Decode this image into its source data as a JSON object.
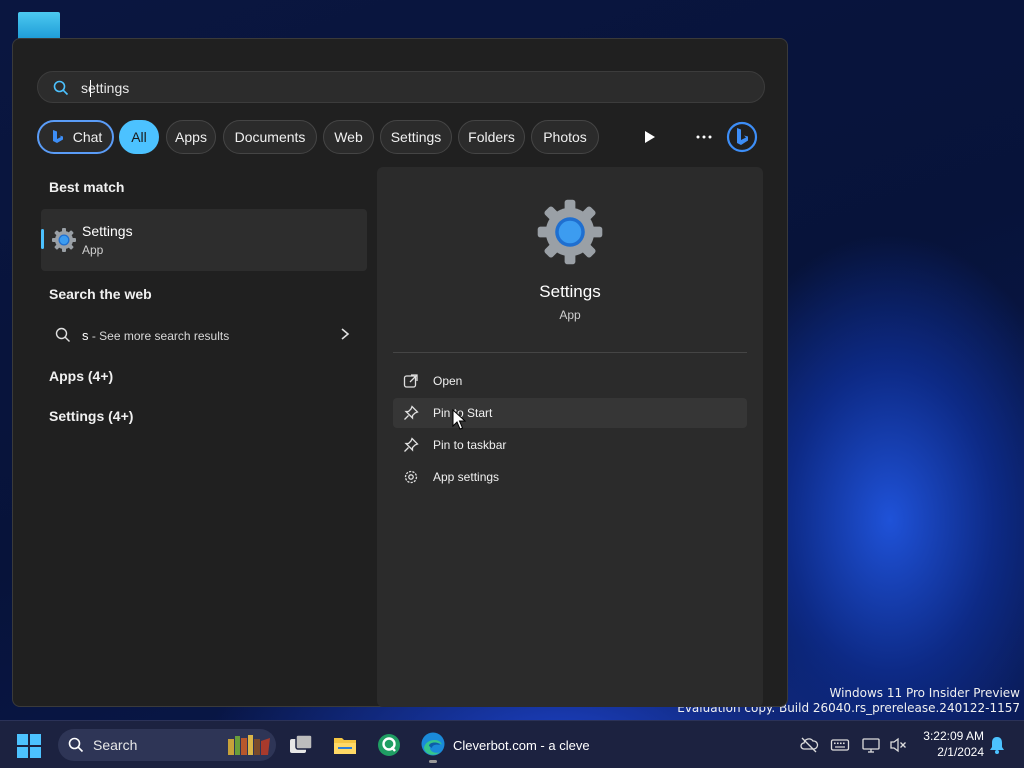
{
  "search": {
    "value": "settings"
  },
  "filters": {
    "chat": "Chat",
    "items": [
      "All",
      "Apps",
      "Documents",
      "Web",
      "Settings",
      "Folders",
      "Photos"
    ]
  },
  "left": {
    "best_match_heading": "Best match",
    "best_match": {
      "title": "Settings",
      "subtitle": "App"
    },
    "search_web_heading": "Search the web",
    "web_result": {
      "query": "s",
      "suffix": " - See more search results"
    },
    "apps_group": "Apps (4+)",
    "settings_group": "Settings (4+)"
  },
  "detail": {
    "title": "Settings",
    "subtitle": "App",
    "actions": [
      "Open",
      "Pin to Start",
      "Pin to taskbar",
      "App settings"
    ]
  },
  "watermark": {
    "line1": "Windows 11 Pro Insider Preview",
    "line2": "Evaluation copy. Build 26040.rs_prerelease.240122-1157"
  },
  "taskbar": {
    "search_label": "Search",
    "edge_window": "Cleverbot.com - a cleve",
    "time": "3:22:09 AM",
    "date": "2/1/2024"
  },
  "colors": {
    "accent": "#4cc2ff",
    "panel": "#202020",
    "detail_panel": "#2b2b2b"
  },
  "icons": [
    "search-icon",
    "bing-chat-icon",
    "play-icon",
    "more-icon",
    "bing-icon",
    "settings-gear-icon",
    "chevron-right-icon",
    "open-external-icon",
    "pin-icon",
    "gear-icon",
    "windows-start-icon",
    "task-view-icon",
    "file-explorer-icon",
    "edge-icon",
    "network-off-icon",
    "keyboard-icon",
    "display-icon",
    "volume-muted-icon",
    "notification-bell-icon"
  ]
}
